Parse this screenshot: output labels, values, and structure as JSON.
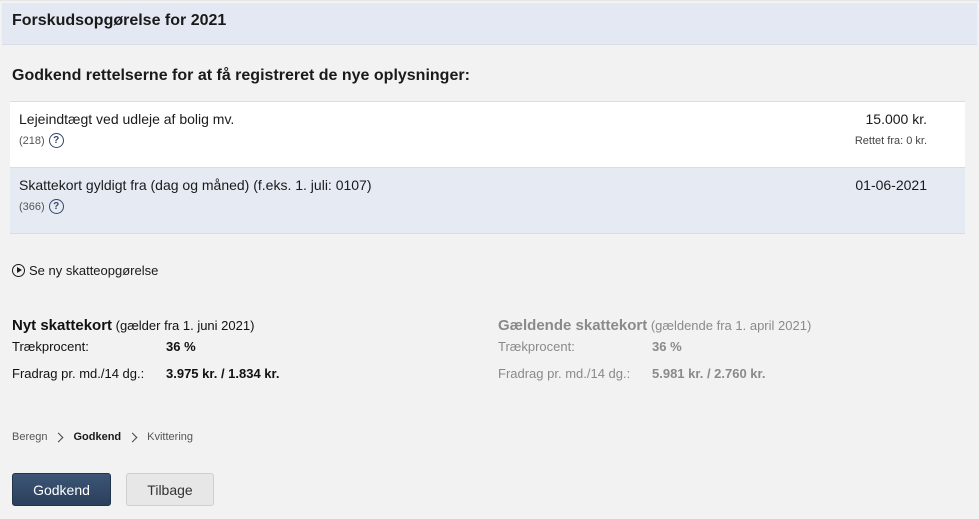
{
  "header": {
    "title": "Forskudsopgørelse for 2021"
  },
  "section": {
    "heading": "Godkend rettelserne for at få registreret de nye oplysninger:"
  },
  "changes": [
    {
      "label": "Lejeindtægt ved udleje af bolig mv.",
      "code": "(218)",
      "value": "15.000 kr.",
      "sub": "Rettet fra: 0 kr."
    },
    {
      "label": "Skattekort gyldigt fra (dag og måned) (f.eks. 1. juli: 0107)",
      "code": "(366)",
      "value": "01-06-2021",
      "sub": ""
    }
  ],
  "help_symbol": "?",
  "show_link": "Se ny skatteopgørelse",
  "new_card": {
    "title": "Nyt skattekort",
    "subtitle": "(gælder fra 1. juni 2021)",
    "rate_label": "Trækprocent:",
    "rate_value": "36 %",
    "deduction_label": "Fradrag pr. md./14 dg.:",
    "deduction_value": "3.975 kr. / 1.834 kr."
  },
  "current_card": {
    "title": "Gældende skattekort",
    "subtitle": "(gældende fra 1. april 2021)",
    "rate_label": "Trækprocent:",
    "rate_value": "36 %",
    "deduction_label": "Fradrag pr. md./14 dg.:",
    "deduction_value": "5.981 kr. / 2.760 kr."
  },
  "breadcrumb": {
    "step1": "Beregn",
    "step2": "Godkend",
    "step3": "Kvittering"
  },
  "buttons": {
    "approve": "Godkend",
    "back": "Tilbage"
  },
  "icons": {
    "help": "help-icon",
    "play": "play-circle-icon",
    "chevron": "chevron-right-icon"
  },
  "colors": {
    "header_bg": "#e3e8f2",
    "row_highlight": "#e6ebf3",
    "primary_button": "#2f4563"
  }
}
